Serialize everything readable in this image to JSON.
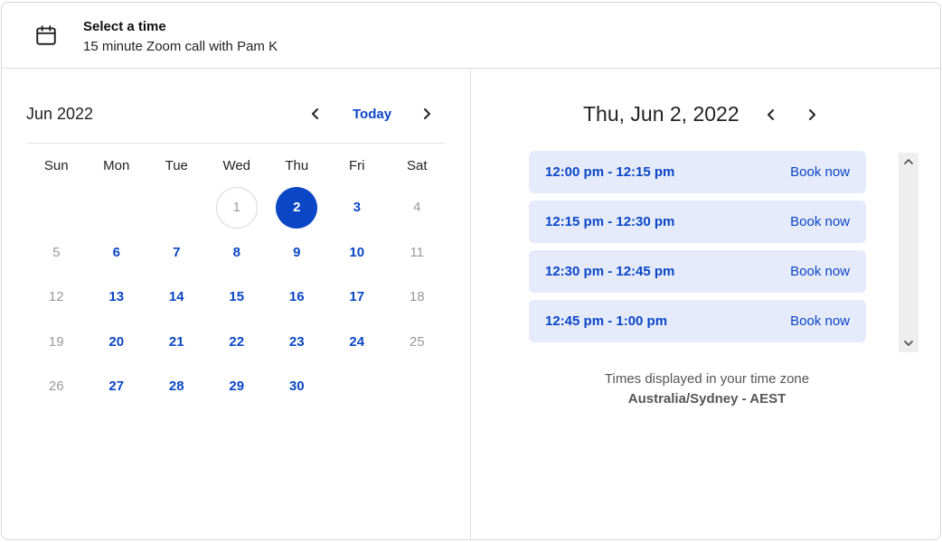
{
  "header": {
    "title": "Select a time",
    "subtitle": "15 minute Zoom call with Pam K",
    "icon": "calendar-icon"
  },
  "calendar": {
    "month_label": "Jun 2022",
    "today_label": "Today",
    "weekdays": [
      "Sun",
      "Mon",
      "Tue",
      "Wed",
      "Thu",
      "Fri",
      "Sat"
    ],
    "weeks": [
      [
        null,
        null,
        null,
        {
          "d": "1",
          "state": "today"
        },
        {
          "d": "2",
          "state": "selected"
        },
        {
          "d": "3",
          "state": "available"
        },
        {
          "d": "4",
          "state": "unavailable"
        }
      ],
      [
        {
          "d": "5",
          "state": "unavailable"
        },
        {
          "d": "6",
          "state": "available"
        },
        {
          "d": "7",
          "state": "available"
        },
        {
          "d": "8",
          "state": "available"
        },
        {
          "d": "9",
          "state": "available"
        },
        {
          "d": "10",
          "state": "available"
        },
        {
          "d": "11",
          "state": "unavailable"
        }
      ],
      [
        {
          "d": "12",
          "state": "unavailable"
        },
        {
          "d": "13",
          "state": "available"
        },
        {
          "d": "14",
          "state": "available"
        },
        {
          "d": "15",
          "state": "available"
        },
        {
          "d": "16",
          "state": "available"
        },
        {
          "d": "17",
          "state": "available"
        },
        {
          "d": "18",
          "state": "unavailable"
        }
      ],
      [
        {
          "d": "19",
          "state": "unavailable"
        },
        {
          "d": "20",
          "state": "available"
        },
        {
          "d": "21",
          "state": "available"
        },
        {
          "d": "22",
          "state": "available"
        },
        {
          "d": "23",
          "state": "available"
        },
        {
          "d": "24",
          "state": "available"
        },
        {
          "d": "25",
          "state": "unavailable"
        }
      ],
      [
        {
          "d": "26",
          "state": "unavailable"
        },
        {
          "d": "27",
          "state": "available"
        },
        {
          "d": "28",
          "state": "available"
        },
        {
          "d": "29",
          "state": "available"
        },
        {
          "d": "30",
          "state": "available"
        },
        null,
        null
      ]
    ]
  },
  "day_view": {
    "date_label": "Thu, Jun 2, 2022",
    "slots": [
      {
        "time": "12:00 pm - 12:15 pm",
        "action": "Book now"
      },
      {
        "time": "12:15 pm - 12:30 pm",
        "action": "Book now"
      },
      {
        "time": "12:30 pm - 12:45 pm",
        "action": "Book now"
      },
      {
        "time": "12:45 pm - 1:00 pm",
        "action": "Book now"
      }
    ],
    "tz_note": "Times displayed in your time zone",
    "tz_name": "Australia/Sydney - AEST"
  },
  "colors": {
    "accent": "#0a46c6",
    "slot_bg": "#e6ebfc",
    "muted": "#9a9a9a"
  }
}
